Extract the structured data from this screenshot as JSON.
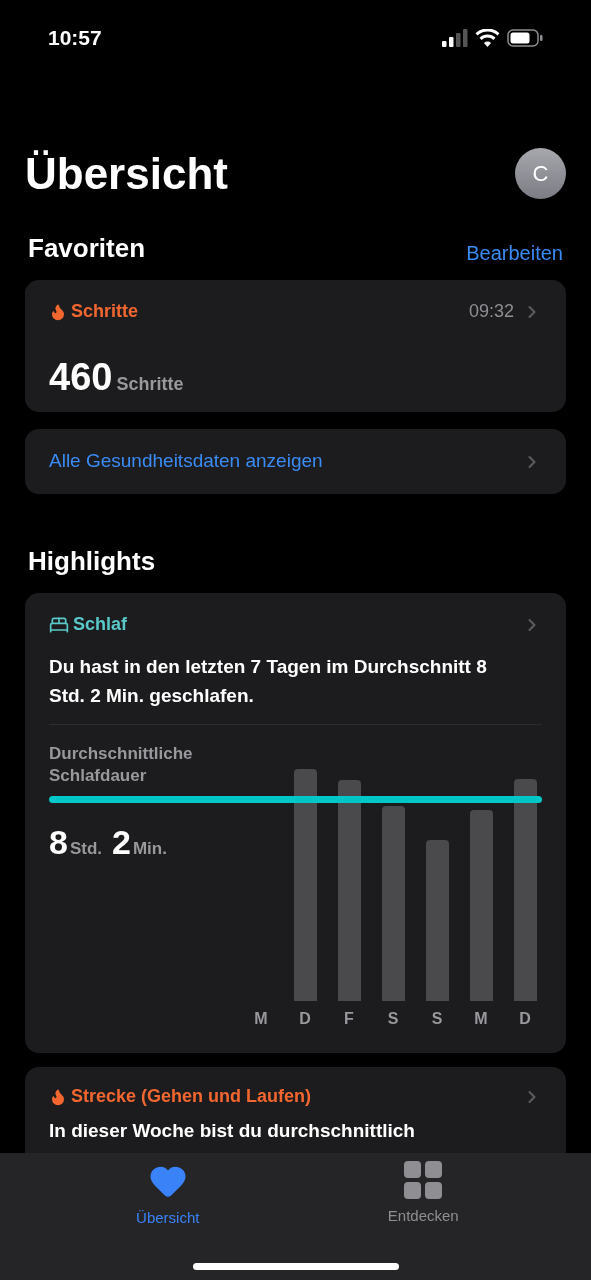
{
  "status_bar": {
    "time": "10:57"
  },
  "header": {
    "title": "Übersicht",
    "avatar": "C"
  },
  "favorites": {
    "title": "Favoriten",
    "edit": "Bearbeiten",
    "card": {
      "label": "Schritte",
      "time": "09:32",
      "value": "460",
      "unit": "Schritte"
    },
    "all_data_link": "Alle Gesundheitsdaten anzeigen"
  },
  "highlights": {
    "title": "Highlights",
    "sleep": {
      "label": "Schlaf",
      "text": "Du hast in den letzten 7 Tagen im Durchschnitt 8 Std. 2 Min. geschlafen.",
      "stat_label": "Durchschnittliche Schlafdauer",
      "hours": "8",
      "hours_unit": "Std.",
      "minutes": "2",
      "minutes_unit": "Min.",
      "days": [
        "M",
        "D",
        "F",
        "S",
        "S",
        "M",
        "D"
      ]
    },
    "distance": {
      "label": "Strecke (Gehen und Laufen)",
      "text": "In dieser Woche bist du durchschnittlich"
    }
  },
  "tab_bar": [
    {
      "label": "Übersicht",
      "kind": "heart",
      "selected": true
    },
    {
      "label": "Entdecken",
      "kind": "grid",
      "selected": false
    }
  ]
}
